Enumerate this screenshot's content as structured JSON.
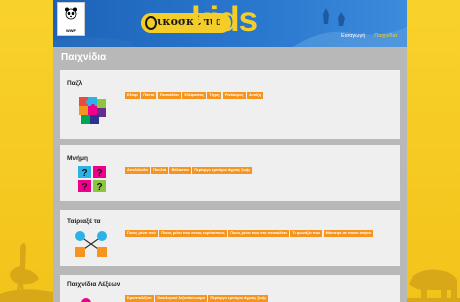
{
  "header": {
    "wwf_label": "WWF",
    "logo_text": "ικοσκόπιο",
    "logo_kids": "kids",
    "nav": [
      {
        "label": "Εισαγωγή",
        "active": false
      },
      {
        "label": "Παιχνίδια",
        "active": true
      }
    ]
  },
  "page_title": "Παιχνίδια",
  "sections": [
    {
      "title": "Παζλ",
      "icon": "puzzle-icon",
      "items": [
        "Ελάφι",
        "Πάντα",
        "Πεσκαλάκι",
        "Ελέφαντας",
        "Τίγρη",
        "Ρινόκερος",
        "Ανοίξη"
      ]
    },
    {
      "title": "Μνήμη",
      "icon": "memory-cards-icon",
      "items": [
        "Απολιθώθα",
        "Πουλιά",
        "Θάλασσα",
        "Περίεργο εμπόριο άγριας ζωής"
      ]
    },
    {
      "title": "Ταίριαξέ τα",
      "icon": "matching-icon",
      "items": [
        "Ποιος μένει πού",
        "Ποιος μένει που στους ευρύτοπους",
        "Ποιος μένει που στο πεσκαλάκι",
        "Τι φωνάζει που",
        "Μάντεψε σε ποιον ανήκει"
      ]
    },
    {
      "title": "Παιχνίδια Λέξεων",
      "icon": "words-icon",
      "items": [
        "Κρυπτολέξιτο",
        "Οικολογικό λεξιπύκνωσμα",
        "Περίεργο εμπόριο άγριας ζωής"
      ]
    }
  ],
  "colors": {
    "background_yellow": "#f6cd22",
    "header_blue": "#2a79cf",
    "chip_orange": "#f7941d",
    "card_bg": "#efefef"
  }
}
